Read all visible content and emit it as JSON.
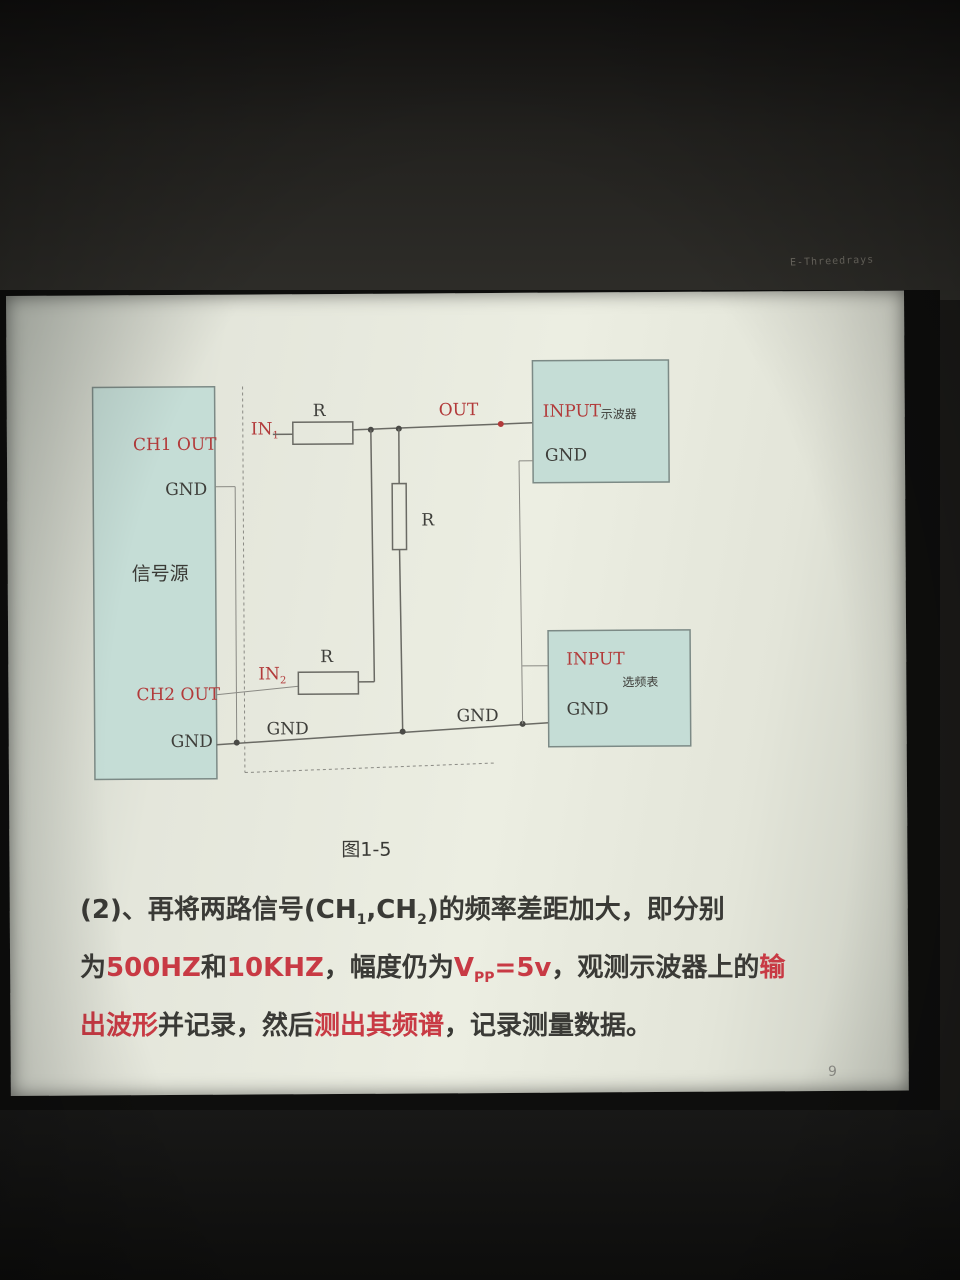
{
  "diagram": {
    "signal_source": {
      "title": "信号源",
      "ch1_out": "CH1  OUT",
      "gnd_1": "GND",
      "ch2_out": "CH2  OUT",
      "gnd_2": "GND"
    },
    "in1": "IN",
    "in1_sub": "1",
    "in2": "IN",
    "in2_sub": "2",
    "r_top": "R",
    "r_mid": "R",
    "r_bottom": "R",
    "out_label": "OUT",
    "gnd_bus_left": "GND",
    "gnd_bus_right": "GND",
    "oscilloscope": {
      "input": "INPUT",
      "name": "示波器",
      "gnd": "GND"
    },
    "meter": {
      "input": "INPUT",
      "name": "选频表",
      "gnd": "GND"
    },
    "caption": "图1-5"
  },
  "text": {
    "p1": "(2)、再将两路信号(CH",
    "p1_sub1": "1",
    "p1_b": ",CH",
    "p1_sub2": "2",
    "p1_c": ")的频率差距加大，即分别",
    "p2_a": "为",
    "p2_red1": "500HZ",
    "p2_b": "和",
    "p2_red2": "10KHZ",
    "p2_c": "，幅度仍为",
    "p2_red3": "V",
    "p2_red3_sub": "PP",
    "p2_red3_b": "=5v",
    "p2_d": "，观测示波器上的",
    "p2_red4": "输",
    "p3_red1": "出波形",
    "p3_a": "并记录，然后",
    "p3_red2": "测出其频谱",
    "p3_b": "，记录测量数据。"
  },
  "page_number": "9",
  "screen_brand": "E-Threedrays",
  "colors": {
    "slide_bg": "#e9ebdf",
    "box_fill": "#c5ddd6",
    "accent_red": "#c83a44",
    "line": "#6a6a64"
  }
}
